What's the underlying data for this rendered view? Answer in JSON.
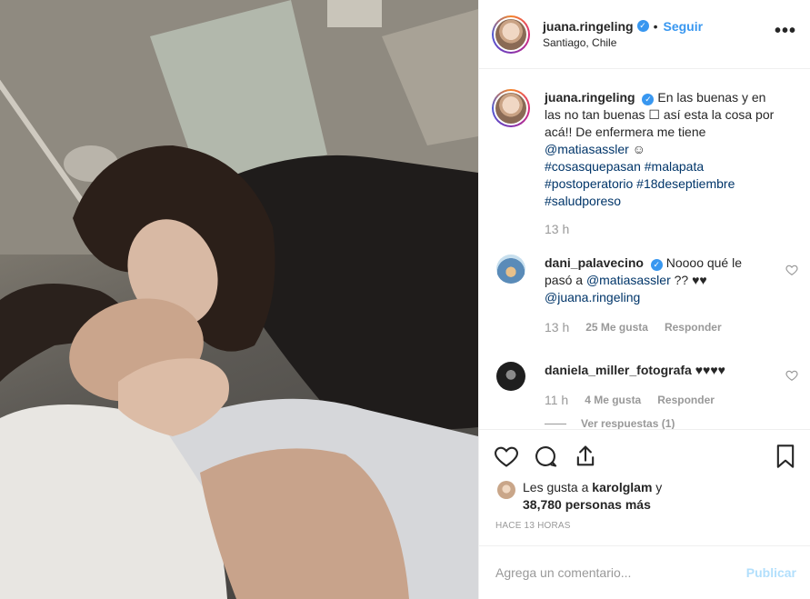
{
  "post": {
    "author": "juana.ringeling",
    "follow_label": "Seguir",
    "separator": "•",
    "location": "Santiago, Chile",
    "more_label": "•••",
    "caption": {
      "user": "juana.ringeling",
      "text1": "En las buenas y en las no tan buenas ",
      "emoji_box": "☐",
      "text2": " así esta la cosa por acá!! De enfermera me tiene ",
      "mention": "@matiasassler",
      "smile": " ☺",
      "tags": "#cosasquepasan #malapata #postoperatorio #18deseptiembre #saludporeso",
      "time": "13 h"
    },
    "comments": [
      {
        "user": "dani_palavecino",
        "text": "Noooo qué le pasó a ",
        "mention1": "@matiasassler",
        "text2": " ?? ♥♥ ",
        "mention2": "@juana.ringeling",
        "time": "13 h",
        "likes": "25 Me gusta",
        "reply": "Responder"
      },
      {
        "user": "daniela_miller_fotografa",
        "text": " ♥♥♥♥",
        "time": "11 h",
        "likes": "4 Me gusta",
        "reply": "Responder"
      }
    ],
    "view_replies": "Ver respuestas (1)",
    "liked_by": {
      "prefix": "Les gusta a ",
      "user": "karolglam",
      "suffix": " y",
      "count": "38,780 personas más"
    },
    "timeago": "HACE 13 HORAS",
    "add_comment_placeholder": "Agrega un comentario...",
    "publish_label": "Publicar"
  },
  "colors": {
    "accent": "#3897f0",
    "mention": "#003569",
    "muted": "#999999",
    "publish_disabled": "#b2dffc"
  },
  "icons": [
    "verified-badge-icon",
    "more-options-icon",
    "heart-icon",
    "comment-icon",
    "share-icon",
    "bookmark-icon"
  ]
}
